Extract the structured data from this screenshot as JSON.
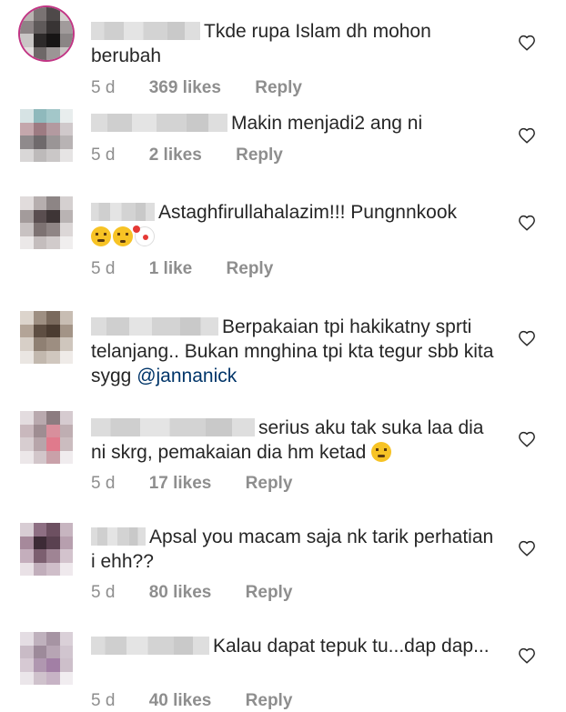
{
  "comments": [
    {
      "text": "Tkde rupa Islam dh mohon berubah",
      "time": "5 d",
      "likes": "369 likes",
      "reply": "Reply",
      "avatar_colors": [
        "#b9b3b1",
        "#7a7373",
        "#4e4949",
        "#d4d0ce",
        "#8c8485",
        "#5f5a5a",
        "#383434",
        "#a19b9b",
        "#c9c6c5",
        "#2d2a2a",
        "#171515",
        "#8a8585",
        "#e2dfde",
        "#6e6868",
        "#9b9595",
        "#c7c3c2"
      ]
    },
    {
      "text": "Makin menjadi2 ang ni",
      "time": "5 d",
      "likes": "2 likes",
      "reply": "Reply",
      "avatar_colors": [
        "#d6e3e4",
        "#8fb9bc",
        "#a3c7c9",
        "#e8eded",
        "#c4a7ac",
        "#9d7b82",
        "#b39aa0",
        "#d0c9cb",
        "#8f8a8c",
        "#6f6a6c",
        "#9a9596",
        "#b8b3b4",
        "#d9d7d7",
        "#bdbaba",
        "#cac7c7",
        "#e6e4e4"
      ]
    },
    {
      "text": "Astaghfirullahalazim!!! Pungnnkook",
      "time": "5 d",
      "likes": "1 like",
      "reply": "Reply",
      "emojis": [
        "laugh",
        "frown",
        "clown"
      ],
      "avatar_colors": [
        "#e1dcdc",
        "#b6aeae",
        "#8d8585",
        "#d5d0d0",
        "#a39b9b",
        "#5a4e50",
        "#3e3536",
        "#b9b3b3",
        "#c8c2c2",
        "#7d7272",
        "#8f8585",
        "#dcd7d7",
        "#ebe8e8",
        "#c4bdbd",
        "#d1cbcb",
        "#f0eeee"
      ]
    },
    {
      "text": "Berpakaian tpi hakikatny sprti telanjang.. Bukan mnghina tpi kta tegur sbb kita sygg",
      "mention": "@jannanick",
      "avatar_colors": [
        "#dcd4cc",
        "#9e8f82",
        "#7a6a5d",
        "#c8bdb3",
        "#b3a497",
        "#5e4e42",
        "#4b3c31",
        "#a39487",
        "#d7cfc7",
        "#8f8073",
        "#9d8e81",
        "#cfc6bd",
        "#eae6e2",
        "#c2b8ae",
        "#d0c7be",
        "#efebe8"
      ]
    },
    {
      "text": "serius aku tak suka laa dia ni skrg, pemakaian dia hm ketad",
      "time": "5 d",
      "likes": "17 likes",
      "reply": "Reply",
      "emojis": [
        "neutral"
      ],
      "avatar_colors": [
        "#e3dcdf",
        "#b9a9ae",
        "#8c7c80",
        "#d6cbd0",
        "#c9b8bd",
        "#9f8d92",
        "#d88f9c",
        "#bfaeb2",
        "#d7cdd0",
        "#b7a5aa",
        "#e07a8c",
        "#cbbcbf",
        "#ece7e9",
        "#d2c6ca",
        "#c9a1a9",
        "#f0ecee"
      ]
    },
    {
      "text": "Apsal you macam saja nk tarik perhatian i ehh??",
      "time": "5 d",
      "likes": "80 likes",
      "reply": "Reply",
      "avatar_colors": [
        "#d8cdd4",
        "#8e6f83",
        "#6d5061",
        "#c7b5c0",
        "#a6899b",
        "#3d2b36",
        "#5a4150",
        "#b79fae",
        "#c4aebc",
        "#7c5f70",
        "#9f8494",
        "#d3c3cd",
        "#e9e1e6",
        "#c1aebb",
        "#cfbec9",
        "#efe9ed"
      ]
    },
    {
      "text": "Kalau dapat tepuk tu...dap dap...",
      "time": "5 d",
      "likes": "40 likes",
      "reply": "Reply",
      "avatar_colors": [
        "#e4dde3",
        "#bfb1bd",
        "#a694a3",
        "#dad0d8",
        "#c9bbc6",
        "#9d8a9a",
        "#b7a5b4",
        "#d1c5cf",
        "#d6c9d3",
        "#b097b0",
        "#a27fa5",
        "#cdbfca",
        "#ebe6ea",
        "#cfc2cc",
        "#c7b3c5",
        "#f1edf0"
      ]
    }
  ]
}
